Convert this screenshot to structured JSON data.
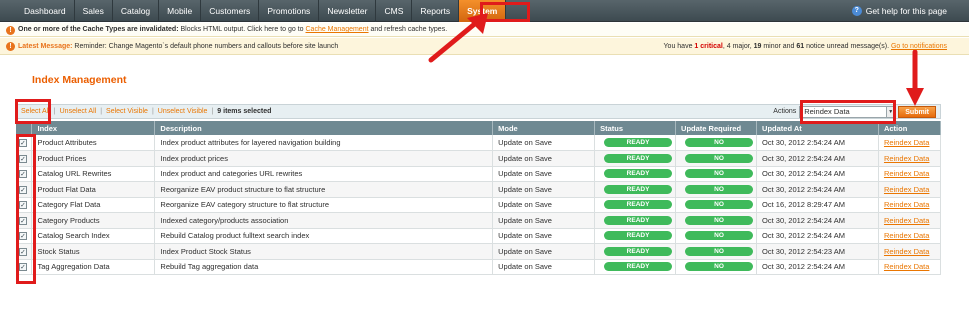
{
  "nav": {
    "items": [
      "Dashboard",
      "Sales",
      "Catalog",
      "Mobile",
      "Customers",
      "Promotions",
      "Newsletter",
      "CMS",
      "Reports",
      "System"
    ],
    "active": "System",
    "help": "Get help for this page"
  },
  "messages": {
    "invalidated_bold": "One or more of the Cache Types are invalidated:",
    "invalidated_text": " Blocks HTML output. Click here to go to ",
    "cache_link": "Cache Management",
    "invalidated_tail": " and refresh cache types.",
    "latest_label": "Latest Message:",
    "latest_text": " Reminder: Change Magento`s default phone numbers and callouts before site launch",
    "summary_pre": "You have ",
    "critical_count": "1 critical",
    "summary_major": ", 4 major, ",
    "minor_count": "19",
    "summary_minor": " minor and ",
    "notice_count": "61",
    "summary_notice": " notice unread message(s). ",
    "notifications_link": "Go to notifications"
  },
  "page": {
    "title": "Index Management"
  },
  "massaction": {
    "select_all": "Select All",
    "unselect_all": "Unselect All",
    "select_visible": "Select Visible",
    "unselect_visible": "Unselect Visible",
    "selected_count": "9 items selected",
    "actions_label": "Actions",
    "action_value": "Reindex Data",
    "submit": "Submit"
  },
  "grid": {
    "headers": [
      "",
      "Index",
      "Description",
      "Mode",
      "Status",
      "Update Required",
      "Updated At",
      "Action"
    ],
    "rows": [
      {
        "index": "Product Attributes",
        "description": "Index product attributes for layered navigation building",
        "mode": "Update on Save",
        "status": "READY",
        "update": "NO",
        "updated": "Oct 30, 2012 2:54:24 AM",
        "action": "Reindex Data"
      },
      {
        "index": "Product Prices",
        "description": "Index product prices",
        "mode": "Update on Save",
        "status": "READY",
        "update": "NO",
        "updated": "Oct 30, 2012 2:54:24 AM",
        "action": "Reindex Data"
      },
      {
        "index": "Catalog URL Rewrites",
        "description": "Index product and categories URL rewrites",
        "mode": "Update on Save",
        "status": "READY",
        "update": "NO",
        "updated": "Oct 30, 2012 2:54:24 AM",
        "action": "Reindex Data"
      },
      {
        "index": "Product Flat Data",
        "description": "Reorganize EAV product structure to flat structure",
        "mode": "Update on Save",
        "status": "READY",
        "update": "NO",
        "updated": "Oct 30, 2012 2:54:24 AM",
        "action": "Reindex Data"
      },
      {
        "index": "Category Flat Data",
        "description": "Reorganize EAV category structure to flat structure",
        "mode": "Update on Save",
        "status": "READY",
        "update": "NO",
        "updated": "Oct 16, 2012 8:29:47 AM",
        "action": "Reindex Data"
      },
      {
        "index": "Category Products",
        "description": "Indexed category/products association",
        "mode": "Update on Save",
        "status": "READY",
        "update": "NO",
        "updated": "Oct 30, 2012 2:54:24 AM",
        "action": "Reindex Data"
      },
      {
        "index": "Catalog Search Index",
        "description": "Rebuild Catalog product fulltext search index",
        "mode": "Update on Save",
        "status": "READY",
        "update": "NO",
        "updated": "Oct 30, 2012 2:54:24 AM",
        "action": "Reindex Data"
      },
      {
        "index": "Stock Status",
        "description": "Index Product Stock Status",
        "mode": "Update on Save",
        "status": "READY",
        "update": "NO",
        "updated": "Oct 30, 2012 2:54:23 AM",
        "action": "Reindex Data"
      },
      {
        "index": "Tag Aggregation Data",
        "description": "Rebuild Tag aggregation data",
        "mode": "Update on Save",
        "status": "READY",
        "update": "NO",
        "updated": "Oct 30, 2012 2:54:24 AM",
        "action": "Reindex Data"
      }
    ]
  },
  "colors": {
    "accent": "#eb5e00",
    "ready": "#3fba5b",
    "annotation": "#e01b1b"
  }
}
